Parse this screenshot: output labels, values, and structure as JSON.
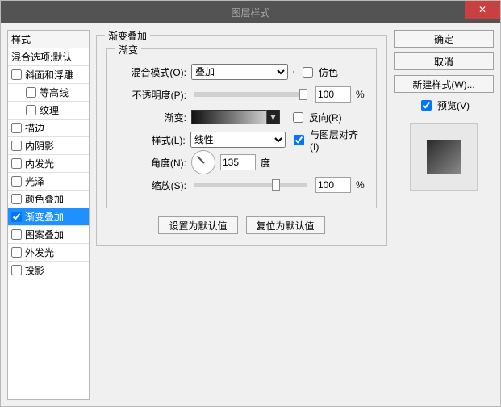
{
  "window": {
    "title": "图层样式"
  },
  "styles_panel": {
    "header": "样式",
    "blend_options": "混合选项:默认",
    "items": [
      {
        "label": "斜面和浮雕",
        "checked": false,
        "indent": 0
      },
      {
        "label": "等高线",
        "checked": false,
        "indent": 1
      },
      {
        "label": "纹理",
        "checked": false,
        "indent": 1
      },
      {
        "label": "描边",
        "checked": false,
        "indent": 0
      },
      {
        "label": "内阴影",
        "checked": false,
        "indent": 0
      },
      {
        "label": "内发光",
        "checked": false,
        "indent": 0
      },
      {
        "label": "光泽",
        "checked": false,
        "indent": 0
      },
      {
        "label": "颜色叠加",
        "checked": false,
        "indent": 0
      },
      {
        "label": "渐变叠加",
        "checked": true,
        "indent": 0,
        "selected": true
      },
      {
        "label": "图案叠加",
        "checked": false,
        "indent": 0
      },
      {
        "label": "外发光",
        "checked": false,
        "indent": 0
      },
      {
        "label": "投影",
        "checked": false,
        "indent": 0
      }
    ]
  },
  "main": {
    "group_title": "渐变叠加",
    "inner_title": "渐变",
    "labels": {
      "blend_mode": "混合模式(O):",
      "opacity": "不透明度(P):",
      "gradient": "渐变:",
      "style": "样式(L):",
      "angle": "角度(N):",
      "scale": "缩放(S):",
      "degree": "度",
      "percent": "%"
    },
    "values": {
      "blend_mode": "叠加",
      "opacity": "100",
      "style": "线性",
      "angle": "135",
      "scale": "100"
    },
    "checks": {
      "dither": {
        "label": "仿色",
        "checked": false
      },
      "reverse": {
        "label": "反向(R)",
        "checked": false
      },
      "align": {
        "label": "与图层对齐(I)",
        "checked": true
      }
    },
    "buttons": {
      "set_default": "设置为默认值",
      "reset_default": "复位为默认值"
    }
  },
  "right": {
    "ok": "确定",
    "cancel": "取消",
    "new_style": "新建样式(W)...",
    "preview": {
      "label": "预览(V)",
      "checked": true
    }
  }
}
